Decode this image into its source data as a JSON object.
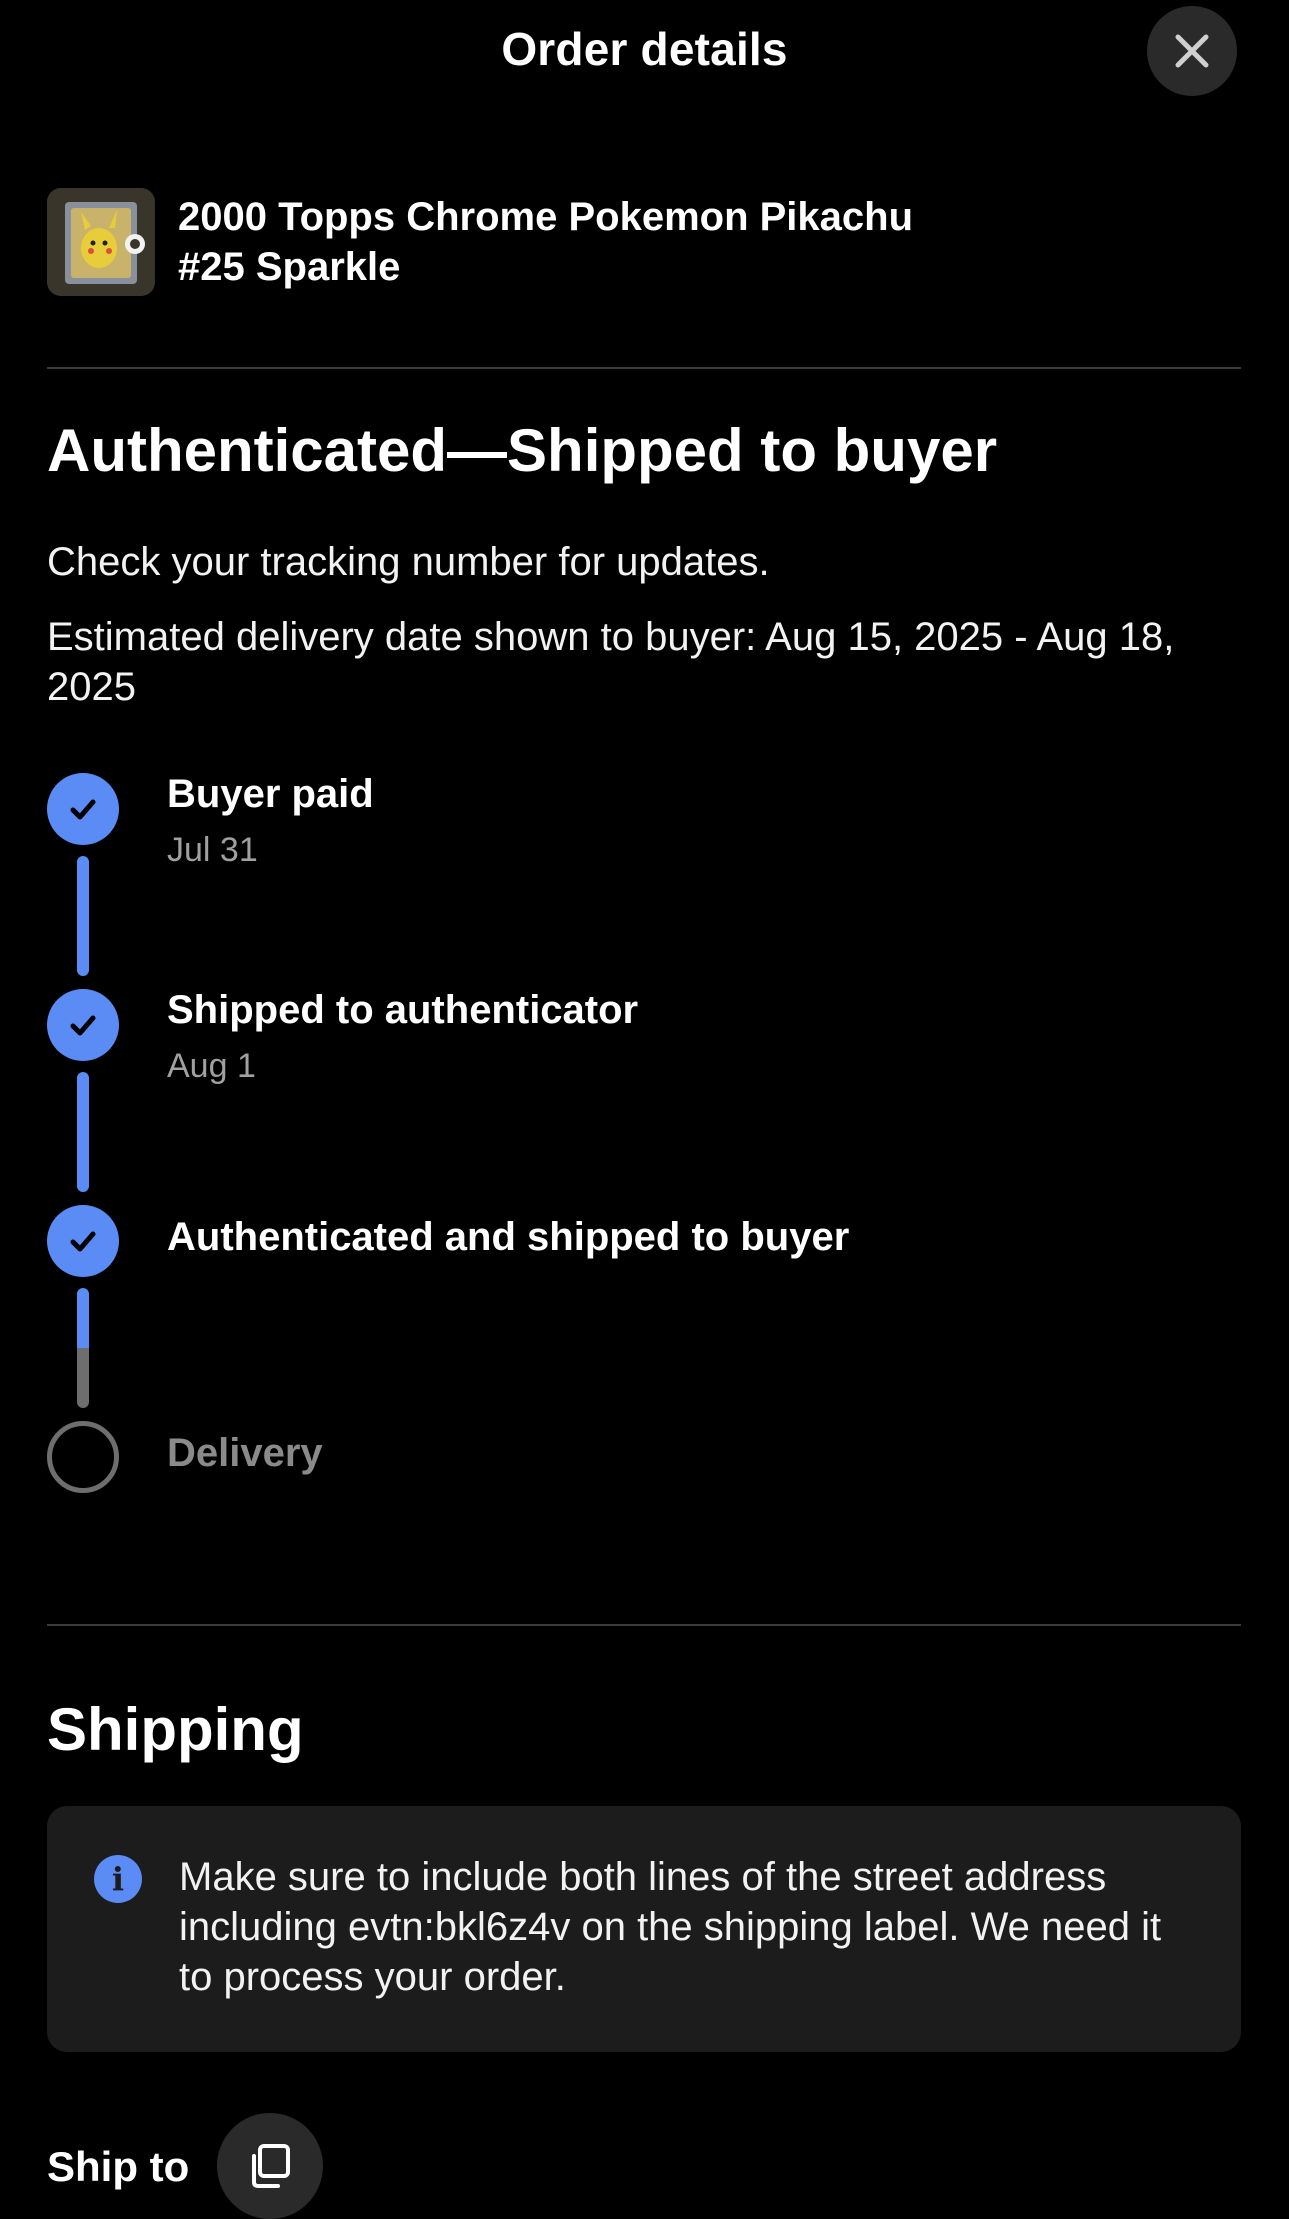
{
  "header": {
    "title": "Order details",
    "close_icon": "close-icon"
  },
  "item": {
    "title_line1": "2000 Topps Chrome Pokemon Pikachu",
    "title_line2": "#25 Sparkle",
    "thumbnail_icon": "pikachu-card-image"
  },
  "status": {
    "heading": "Authenticated—Shipped to buyer",
    "tracking_note": "Check your tracking number for updates.",
    "delivery_estimate": "Estimated delivery date shown to buyer: Aug 15, 2025 - Aug 18, 2025"
  },
  "timeline": {
    "steps": [
      {
        "label": "Buyer paid",
        "date": "Jul 31",
        "completed": true
      },
      {
        "label": "Shipped to authenticator",
        "date": "Aug 1",
        "completed": true
      },
      {
        "label": "Authenticated and shipped to buyer",
        "date": "",
        "completed": true
      },
      {
        "label": "Delivery",
        "date": "",
        "completed": false
      }
    ]
  },
  "shipping": {
    "heading": "Shipping",
    "notice_icon": "info-icon",
    "notice_text": "Make sure to include both lines of the street address including evtn:bkl6z4v on the shipping label. We need it to process your order.",
    "ship_to_label": "Ship to",
    "copy_icon": "copy-icon"
  },
  "colors": {
    "accent": "#5b8bf5",
    "background": "#000000",
    "pending": "#6e6e6e"
  }
}
